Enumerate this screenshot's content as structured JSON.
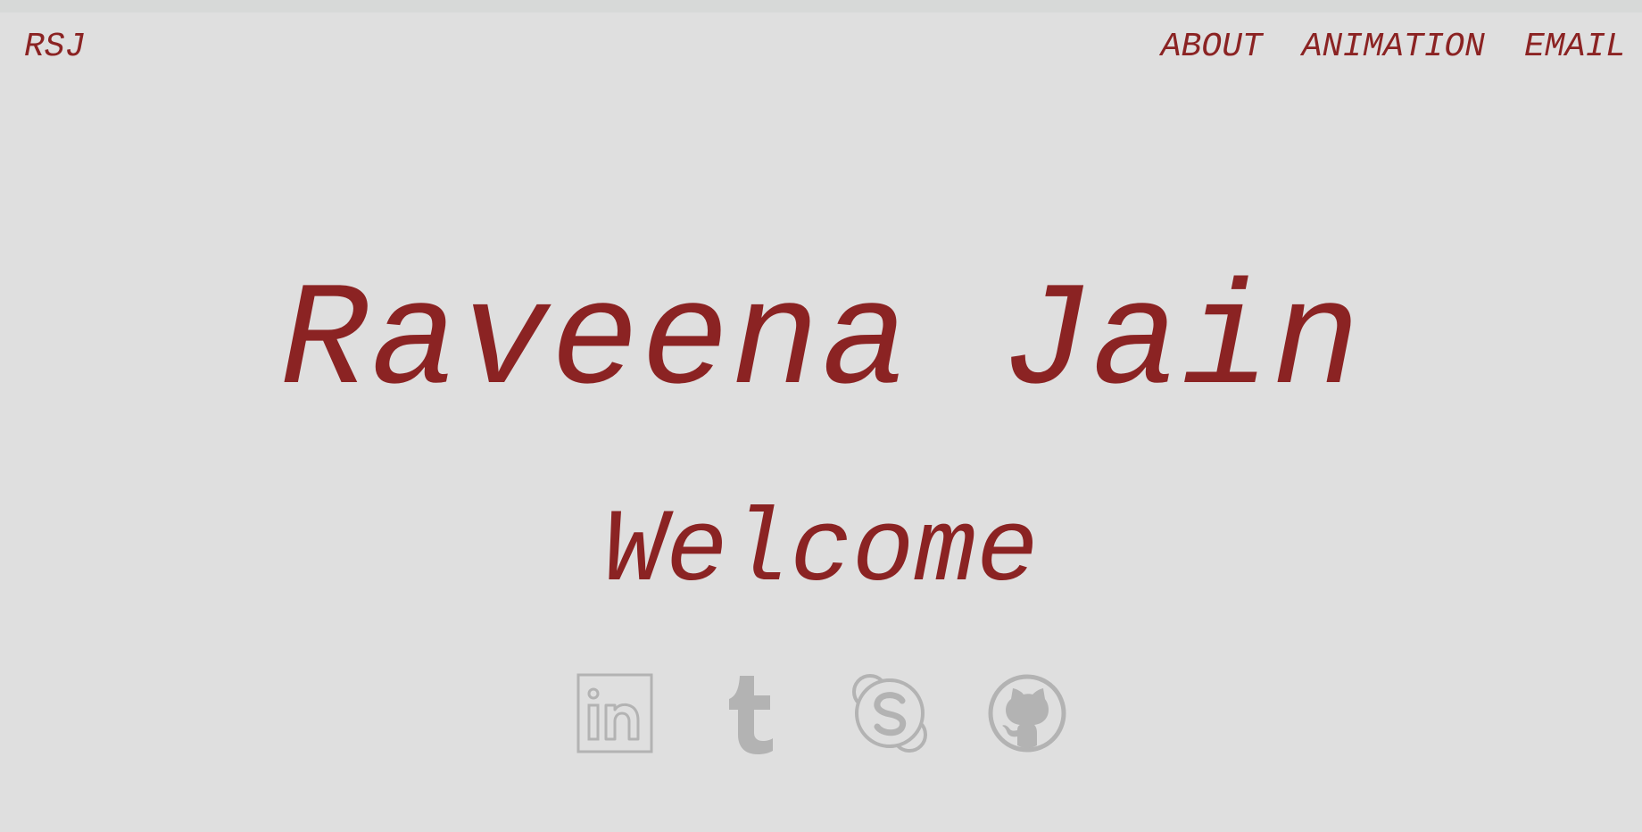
{
  "header": {
    "brand": "RSJ",
    "nav": [
      {
        "label": "ABOUT"
      },
      {
        "label": "ANIMATION"
      },
      {
        "label": "EMAIL"
      }
    ]
  },
  "hero": {
    "name": "Raveena Jain",
    "subtitle": "Welcome"
  },
  "socials": [
    {
      "icon": "linkedin-icon"
    },
    {
      "icon": "tumblr-icon"
    },
    {
      "icon": "skype-icon"
    },
    {
      "icon": "github-icon"
    }
  ],
  "colors": {
    "background": "#dfdfdf",
    "accent": "#8b2323",
    "icon": "#b3b3b3"
  }
}
